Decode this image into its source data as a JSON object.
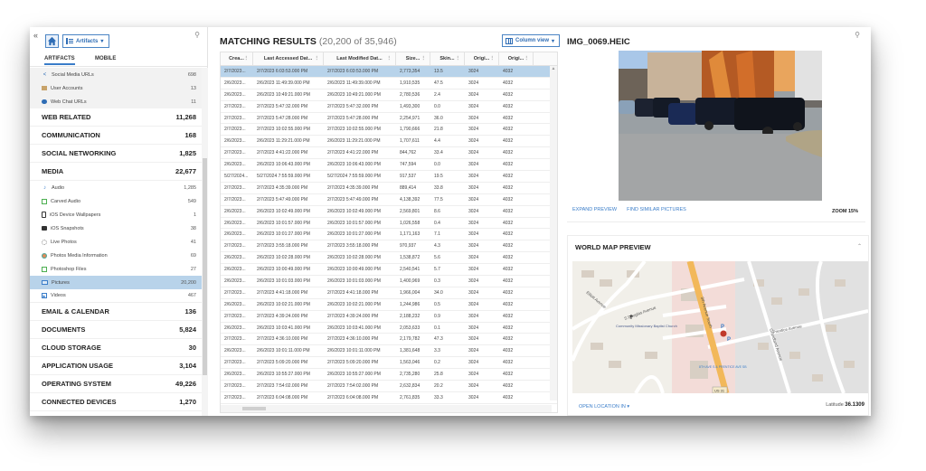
{
  "sidebar": {
    "collapse_icon": "«",
    "artifacts_button": "Artifacts",
    "tabs": [
      {
        "label": "ARTIFACTS",
        "active": true
      },
      {
        "label": "MOBILE",
        "active": false
      }
    ],
    "top_subitems": [
      {
        "label": "Social Media URLs",
        "count": "698",
        "icon": "share-icon"
      },
      {
        "label": "User Accounts",
        "count": "13",
        "icon": "user-accounts-icon"
      },
      {
        "label": "Web Chat URLs",
        "count": "11",
        "icon": "chat-icon"
      }
    ],
    "categories_before_media": [
      {
        "label": "WEB RELATED",
        "count": "11,268"
      },
      {
        "label": "COMMUNICATION",
        "count": "168"
      },
      {
        "label": "SOCIAL NETWORKING",
        "count": "1,825"
      }
    ],
    "media": {
      "label": "MEDIA",
      "count": "22,677",
      "items": [
        {
          "label": "Audio",
          "count": "1,285",
          "icon": "audio-icon"
        },
        {
          "label": "Carved Audio",
          "count": "549",
          "icon": "carved-audio-icon"
        },
        {
          "label": "iOS Device Wallpapers",
          "count": "1",
          "icon": "phone-icon"
        },
        {
          "label": "iOS Snapshots",
          "count": "38",
          "icon": "camera-icon"
        },
        {
          "label": "Live Photos",
          "count": "41",
          "icon": "live-photo-icon"
        },
        {
          "label": "Photos Media Information",
          "count": "69",
          "icon": "photos-icon"
        },
        {
          "label": "Photoshop Files",
          "count": "27",
          "icon": "photoshop-icon"
        },
        {
          "label": "Pictures",
          "count": "20,200",
          "icon": "picture-icon",
          "selected": true
        },
        {
          "label": "Videos",
          "count": "467",
          "icon": "video-icon"
        }
      ]
    },
    "categories_after_media": [
      {
        "label": "EMAIL & CALENDAR",
        "count": "136"
      },
      {
        "label": "DOCUMENTS",
        "count": "5,824"
      },
      {
        "label": "CLOUD STORAGE",
        "count": "30"
      },
      {
        "label": "APPLICATION USAGE",
        "count": "3,104"
      },
      {
        "label": "OPERATING SYSTEM",
        "count": "49,226"
      },
      {
        "label": "CONNECTED DEVICES",
        "count": "1,270"
      }
    ]
  },
  "results": {
    "title": "MATCHING RESULTS",
    "count_text": "(20,200 of 35,946)",
    "column_view_button": "Column view",
    "columns": [
      "Crea...",
      "Last Accessed Dat...",
      "Last Modified Dat...",
      "Size...",
      "Skin...",
      "Origi...",
      "Origi..."
    ],
    "rows": [
      [
        "2/7/2023...",
        "2/7/2023 6:03:53.000 PM",
        "2/7/2023 6:03:53.000 PM",
        "2,773,354",
        "13.5",
        "3024",
        "4032"
      ],
      [
        "2/6/2023...",
        "2/6/2023 11:49:39.000 PM",
        "2/6/2023 11:49:39.000 PM",
        "1,910,535",
        "47.5",
        "3024",
        "4032"
      ],
      [
        "2/6/2023...",
        "2/6/2023 10:49:21.000 PM",
        "2/6/2023 10:49:21.000 PM",
        "2,780,536",
        "2.4",
        "3024",
        "4032"
      ],
      [
        "2/7/2023...",
        "2/7/2023 5:47:32.000 PM",
        "2/7/2023 5:47:32.000 PM",
        "1,493,300",
        "0.0",
        "3024",
        "4032"
      ],
      [
        "2/7/2023...",
        "2/7/2023 5:47:28.000 PM",
        "2/7/2023 5:47:28.000 PM",
        "2,254,971",
        "36.0",
        "3024",
        "4032"
      ],
      [
        "2/7/2023...",
        "2/7/2023 10:02:55.000 PM",
        "2/7/2023 10:02:55.000 PM",
        "1,790,666",
        "21.8",
        "3024",
        "4032"
      ],
      [
        "2/6/2023...",
        "2/6/2023 11:29:21.000 PM",
        "2/6/2023 11:29:21.000 PM",
        "1,707,611",
        "4.4",
        "3024",
        "4032"
      ],
      [
        "2/7/2023...",
        "2/7/2023 4:41:22.000 PM",
        "2/7/2023 4:41:22.000 PM",
        "844,762",
        "33.4",
        "3024",
        "4032"
      ],
      [
        "2/6/2023...",
        "2/6/2023 10:06:43.000 PM",
        "2/6/2023 10:06:43.000 PM",
        "747,594",
        "0.0",
        "3024",
        "4032"
      ],
      [
        "5/27/2024...",
        "5/27/2024 7:55:59.000 PM",
        "5/27/2024 7:55:59.000 PM",
        "917,537",
        "19.5",
        "3024",
        "4032"
      ],
      [
        "2/7/2023...",
        "2/7/2023 4:35:39.000 PM",
        "2/7/2023 4:35:39.000 PM",
        "889,414",
        "33.8",
        "3024",
        "4032"
      ],
      [
        "2/7/2023...",
        "2/7/2023 5:47:49.000 PM",
        "2/7/2023 5:47:49.000 PM",
        "4,138,392",
        "77.5",
        "3024",
        "4032"
      ],
      [
        "2/6/2023...",
        "2/6/2023 10:02:49.000 PM",
        "2/6/2023 10:02:49.000 PM",
        "2,569,801",
        "8.6",
        "3024",
        "4032"
      ],
      [
        "2/6/2023...",
        "2/6/2023 10:01:57.000 PM",
        "2/6/2023 10:01:57.000 PM",
        "1,026,558",
        "0.4",
        "3024",
        "4032"
      ],
      [
        "2/6/2023...",
        "2/6/2023 10:01:27.000 PM",
        "2/6/2023 10:01:27.000 PM",
        "1,171,163",
        "7.1",
        "3024",
        "4032"
      ],
      [
        "2/7/2023...",
        "2/7/2023 3:55:18.000 PM",
        "2/7/2023 3:55:18.000 PM",
        "970,937",
        "4.3",
        "3024",
        "4032"
      ],
      [
        "2/6/2023...",
        "2/6/2023 10:02:28.000 PM",
        "2/6/2023 10:02:28.000 PM",
        "1,538,872",
        "5.6",
        "3024",
        "4032"
      ],
      [
        "2/6/2023...",
        "2/6/2023 10:00:49.000 PM",
        "2/6/2023 10:00:49.000 PM",
        "2,540,541",
        "5.7",
        "3024",
        "4032"
      ],
      [
        "2/6/2023...",
        "2/6/2023 10:01:03.000 PM",
        "2/6/2023 10:01:03.000 PM",
        "1,400,969",
        "0.3",
        "3024",
        "4032"
      ],
      [
        "2/7/2023...",
        "2/7/2023 4:41:18.000 PM",
        "2/7/2023 4:41:18.000 PM",
        "1,966,004",
        "34.0",
        "3024",
        "4032"
      ],
      [
        "2/6/2023...",
        "2/6/2023 10:02:21.000 PM",
        "2/6/2023 10:02:21.000 PM",
        "1,244,986",
        "0.5",
        "3024",
        "4032"
      ],
      [
        "2/7/2023...",
        "2/7/2023 4:39:24.000 PM",
        "2/7/2023 4:39:24.000 PM",
        "2,188,232",
        "0.9",
        "3024",
        "4032"
      ],
      [
        "2/6/2023...",
        "2/6/2023 10:03:41.000 PM",
        "2/6/2023 10:03:41.000 PM",
        "2,053,633",
        "0.1",
        "3024",
        "4032"
      ],
      [
        "2/7/2023...",
        "2/7/2023 4:36:10.000 PM",
        "2/7/2023 4:36:10.000 PM",
        "2,179,782",
        "47.3",
        "3024",
        "4032"
      ],
      [
        "2/6/2023...",
        "2/6/2023 10:01:11.000 PM",
        "2/6/2023 10:01:11.000 PM",
        "1,381,648",
        "3.3",
        "3024",
        "4032"
      ],
      [
        "2/7/2023...",
        "2/7/2023 5:09:20.000 PM",
        "2/7/2023 5:09:20.000 PM",
        "1,563,046",
        "0.2",
        "3024",
        "4032"
      ],
      [
        "2/6/2023...",
        "2/6/2023 10:55:27.000 PM",
        "2/6/2023 10:55:27.000 PM",
        "2,735,280",
        "25.8",
        "3024",
        "4032"
      ],
      [
        "2/7/2023...",
        "2/7/2023 7:54:02.000 PM",
        "2/7/2023 7:54:02.000 PM",
        "2,632,834",
        "20.2",
        "3024",
        "4032"
      ],
      [
        "2/7/2023...",
        "2/7/2023 6:04:08.000 PM",
        "2/7/2023 6:04:08.000 PM",
        "2,761,835",
        "33.3",
        "3024",
        "4032"
      ]
    ]
  },
  "preview": {
    "filename": "IMG_0069.HEIC",
    "expand_link": "EXPAND PREVIEW",
    "similar_link": "FIND SIMILAR PICTURES",
    "zoom_label": "ZOOM 15%",
    "map_title": "WORLD MAP PREVIEW",
    "open_location": "OPEN LOCATION IN",
    "latitude_label": "Latitude",
    "latitude_value": "36.1309",
    "map_labels": {
      "street1": "S Douglas Avenue",
      "street2": "Elliott Avenue",
      "street3": "8th Avenue South",
      "street4": "Prentice Avenue",
      "street5": "Grandland Avenue",
      "church": "Community Missionary Baptist Church",
      "bus_stop": "8TH AVE S & PRENTICE AVE SB",
      "route": "US 31"
    }
  },
  "colors": {
    "accent": "#3a7dc9",
    "selected_row": "#b8d3ea"
  }
}
